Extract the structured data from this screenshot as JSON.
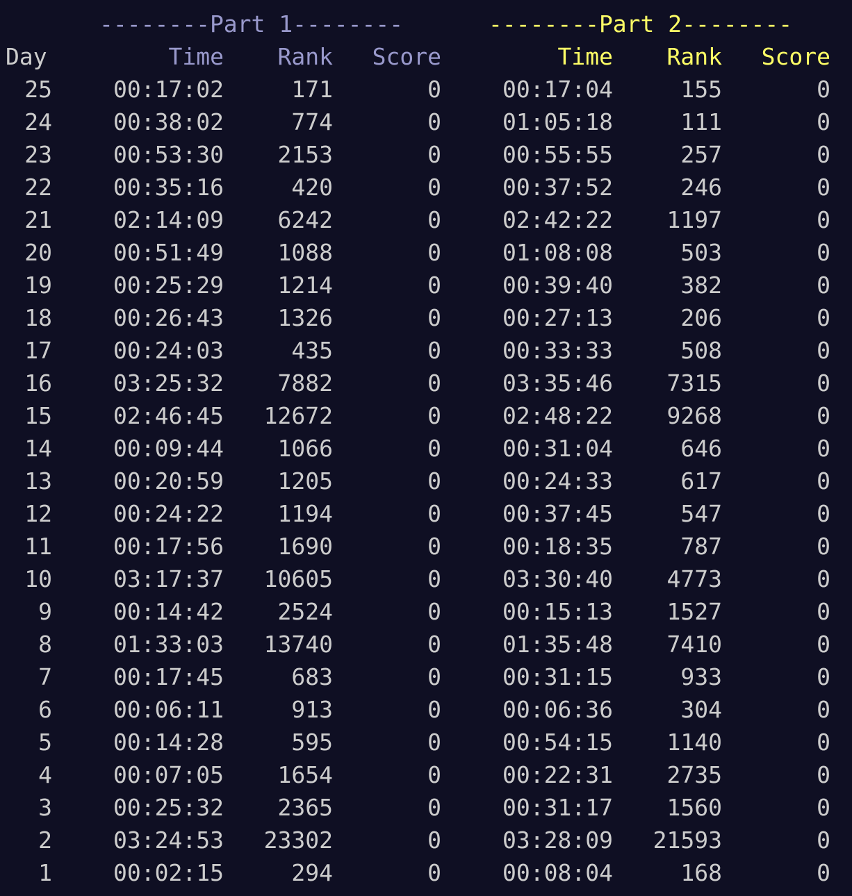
{
  "headers": {
    "part1": "--------Part 1--------",
    "part2": "--------Part 2--------",
    "day": "Day",
    "time": "Time",
    "rank": "Rank",
    "score": "Score"
  },
  "colors": {
    "background": "#0f0f23",
    "text": "#cccccc",
    "part1": "#9999cc",
    "part2": "#ffff66"
  },
  "rows": [
    {
      "day": "25",
      "p1_time": "00:17:02",
      "p1_rank": "171",
      "p1_score": "0",
      "p2_time": "00:17:04",
      "p2_rank": "155",
      "p2_score": "0"
    },
    {
      "day": "24",
      "p1_time": "00:38:02",
      "p1_rank": "774",
      "p1_score": "0",
      "p2_time": "01:05:18",
      "p2_rank": "111",
      "p2_score": "0"
    },
    {
      "day": "23",
      "p1_time": "00:53:30",
      "p1_rank": "2153",
      "p1_score": "0",
      "p2_time": "00:55:55",
      "p2_rank": "257",
      "p2_score": "0"
    },
    {
      "day": "22",
      "p1_time": "00:35:16",
      "p1_rank": "420",
      "p1_score": "0",
      "p2_time": "00:37:52",
      "p2_rank": "246",
      "p2_score": "0"
    },
    {
      "day": "21",
      "p1_time": "02:14:09",
      "p1_rank": "6242",
      "p1_score": "0",
      "p2_time": "02:42:22",
      "p2_rank": "1197",
      "p2_score": "0"
    },
    {
      "day": "20",
      "p1_time": "00:51:49",
      "p1_rank": "1088",
      "p1_score": "0",
      "p2_time": "01:08:08",
      "p2_rank": "503",
      "p2_score": "0"
    },
    {
      "day": "19",
      "p1_time": "00:25:29",
      "p1_rank": "1214",
      "p1_score": "0",
      "p2_time": "00:39:40",
      "p2_rank": "382",
      "p2_score": "0"
    },
    {
      "day": "18",
      "p1_time": "00:26:43",
      "p1_rank": "1326",
      "p1_score": "0",
      "p2_time": "00:27:13",
      "p2_rank": "206",
      "p2_score": "0"
    },
    {
      "day": "17",
      "p1_time": "00:24:03",
      "p1_rank": "435",
      "p1_score": "0",
      "p2_time": "00:33:33",
      "p2_rank": "508",
      "p2_score": "0"
    },
    {
      "day": "16",
      "p1_time": "03:25:32",
      "p1_rank": "7882",
      "p1_score": "0",
      "p2_time": "03:35:46",
      "p2_rank": "7315",
      "p2_score": "0"
    },
    {
      "day": "15",
      "p1_time": "02:46:45",
      "p1_rank": "12672",
      "p1_score": "0",
      "p2_time": "02:48:22",
      "p2_rank": "9268",
      "p2_score": "0"
    },
    {
      "day": "14",
      "p1_time": "00:09:44",
      "p1_rank": "1066",
      "p1_score": "0",
      "p2_time": "00:31:04",
      "p2_rank": "646",
      "p2_score": "0"
    },
    {
      "day": "13",
      "p1_time": "00:20:59",
      "p1_rank": "1205",
      "p1_score": "0",
      "p2_time": "00:24:33",
      "p2_rank": "617",
      "p2_score": "0"
    },
    {
      "day": "12",
      "p1_time": "00:24:22",
      "p1_rank": "1194",
      "p1_score": "0",
      "p2_time": "00:37:45",
      "p2_rank": "547",
      "p2_score": "0"
    },
    {
      "day": "11",
      "p1_time": "00:17:56",
      "p1_rank": "1690",
      "p1_score": "0",
      "p2_time": "00:18:35",
      "p2_rank": "787",
      "p2_score": "0"
    },
    {
      "day": "10",
      "p1_time": "03:17:37",
      "p1_rank": "10605",
      "p1_score": "0",
      "p2_time": "03:30:40",
      "p2_rank": "4773",
      "p2_score": "0"
    },
    {
      "day": "9",
      "p1_time": "00:14:42",
      "p1_rank": "2524",
      "p1_score": "0",
      "p2_time": "00:15:13",
      "p2_rank": "1527",
      "p2_score": "0"
    },
    {
      "day": "8",
      "p1_time": "01:33:03",
      "p1_rank": "13740",
      "p1_score": "0",
      "p2_time": "01:35:48",
      "p2_rank": "7410",
      "p2_score": "0"
    },
    {
      "day": "7",
      "p1_time": "00:17:45",
      "p1_rank": "683",
      "p1_score": "0",
      "p2_time": "00:31:15",
      "p2_rank": "933",
      "p2_score": "0"
    },
    {
      "day": "6",
      "p1_time": "00:06:11",
      "p1_rank": "913",
      "p1_score": "0",
      "p2_time": "00:06:36",
      "p2_rank": "304",
      "p2_score": "0"
    },
    {
      "day": "5",
      "p1_time": "00:14:28",
      "p1_rank": "595",
      "p1_score": "0",
      "p2_time": "00:54:15",
      "p2_rank": "1140",
      "p2_score": "0"
    },
    {
      "day": "4",
      "p1_time": "00:07:05",
      "p1_rank": "1654",
      "p1_score": "0",
      "p2_time": "00:22:31",
      "p2_rank": "2735",
      "p2_score": "0"
    },
    {
      "day": "3",
      "p1_time": "00:25:32",
      "p1_rank": "2365",
      "p1_score": "0",
      "p2_time": "00:31:17",
      "p2_rank": "1560",
      "p2_score": "0"
    },
    {
      "day": "2",
      "p1_time": "03:24:53",
      "p1_rank": "23302",
      "p1_score": "0",
      "p2_time": "03:28:09",
      "p2_rank": "21593",
      "p2_score": "0"
    },
    {
      "day": "1",
      "p1_time": "00:02:15",
      "p1_rank": "294",
      "p1_score": "0",
      "p2_time": "00:08:04",
      "p2_rank": "168",
      "p2_score": "0"
    }
  ]
}
